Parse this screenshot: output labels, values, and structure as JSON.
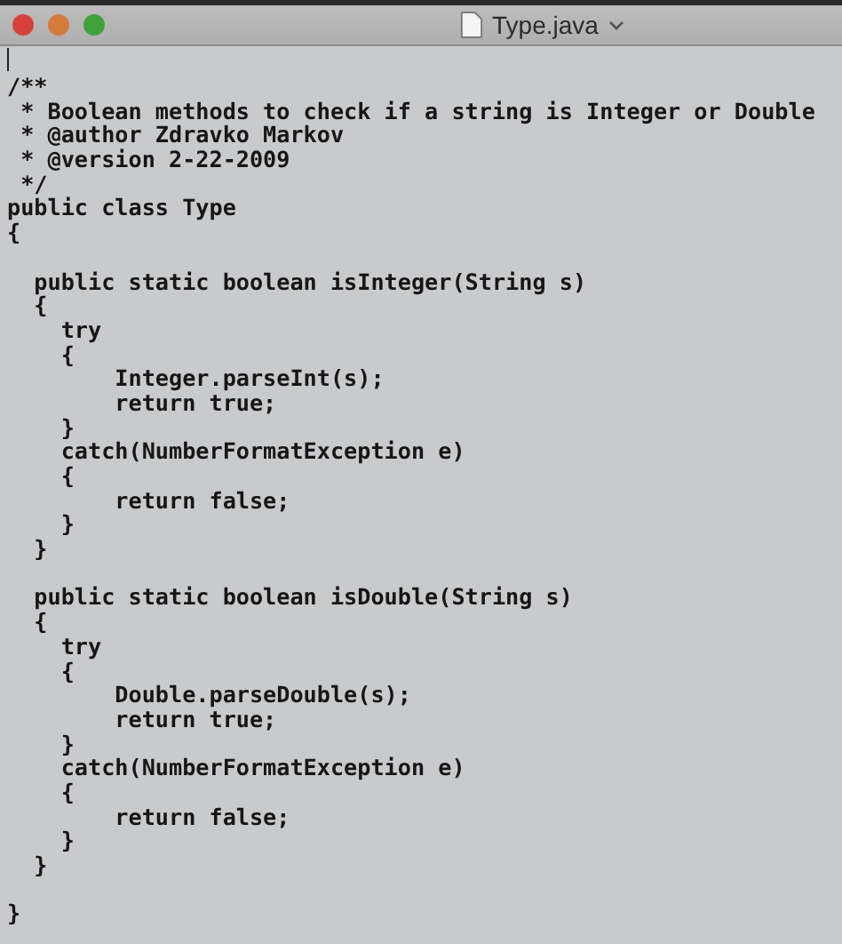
{
  "window": {
    "title": "Type.java"
  },
  "editor": {
    "caret": true,
    "blocks": [
      {
        "lines": [
          "/**",
          " * Boolean methods to check if a string is Integer or Double",
          " * @author Zdravko Markov",
          " * @version 2-22-2009",
          " */",
          "public class Type",
          "{"
        ]
      },
      {
        "lines": [
          "  public static boolean isInteger(String s)",
          "  {",
          "    try",
          "    {",
          "        Integer.parseInt(s);",
          "        return true;",
          "    }",
          "    catch(NumberFormatException e)",
          "    {",
          "        return false;",
          "    }",
          "  }"
        ]
      },
      {
        "lines": [
          "  public static boolean isDouble(String s)",
          "  {",
          "    try",
          "    {",
          "        Double.parseDouble(s);",
          "        return true;",
          "    }",
          "    catch(NumberFormatException e)",
          "    {",
          "        return false;",
          "    }",
          "  }"
        ]
      },
      {
        "lines": [
          "}"
        ]
      }
    ]
  }
}
